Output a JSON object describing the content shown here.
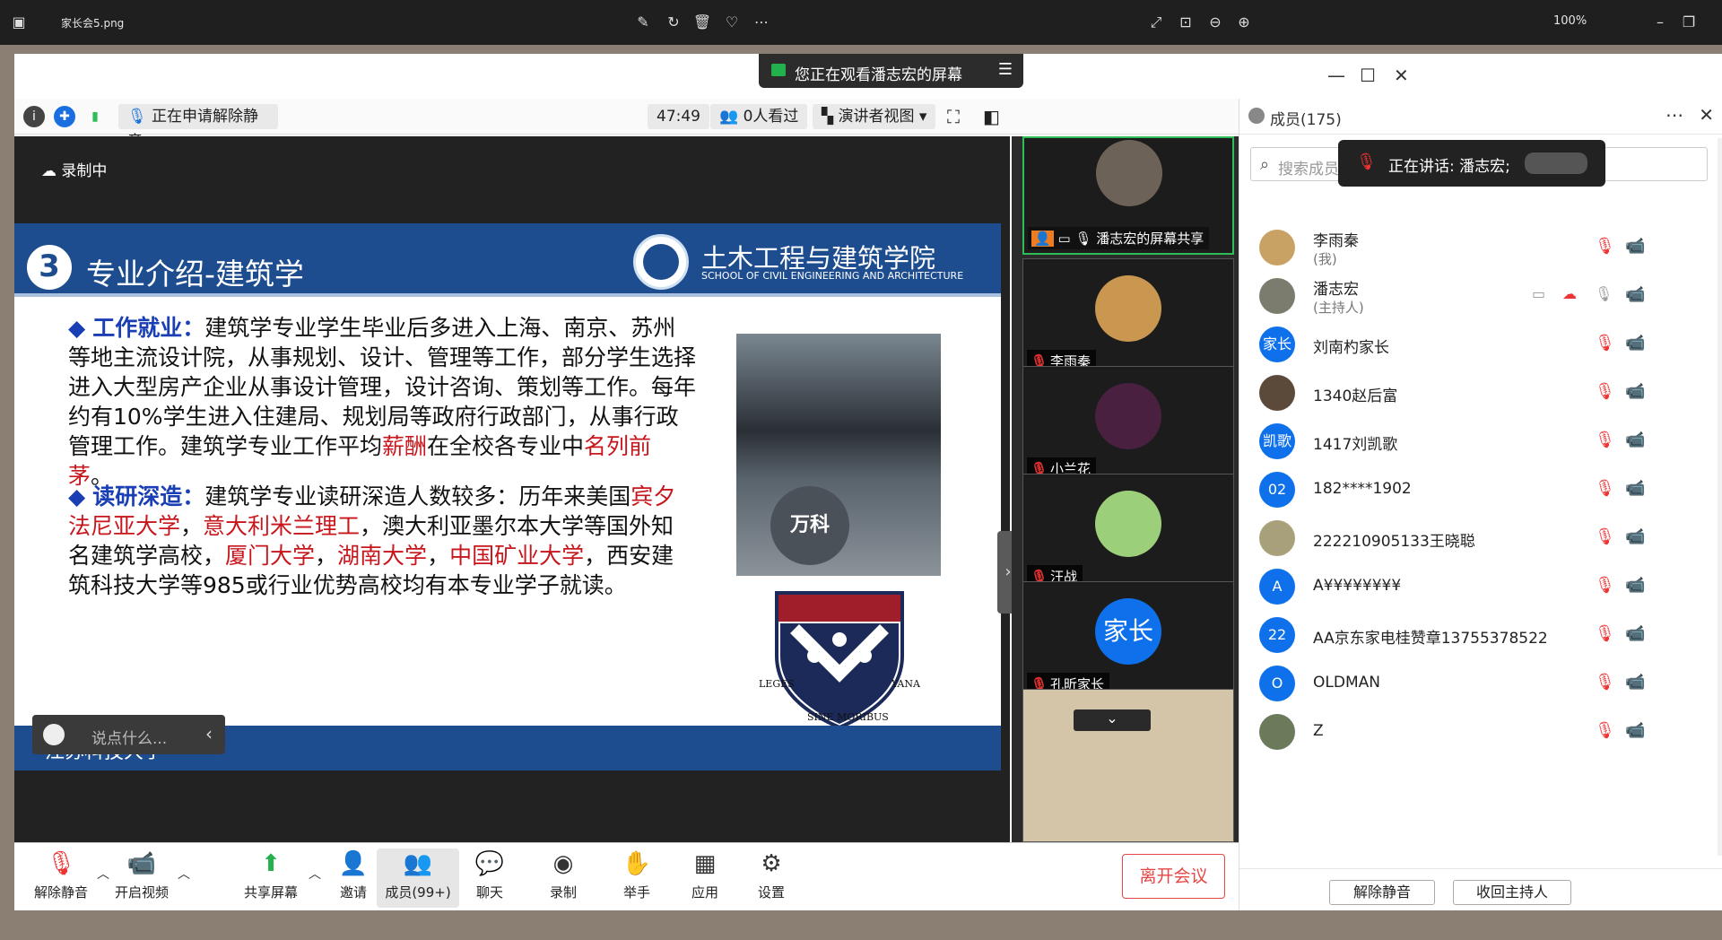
{
  "viewer": {
    "filename": "家长会5.png",
    "zoom": "100%",
    "icons": [
      "image-icon",
      "edit-icon",
      "rotate-icon",
      "delete-icon",
      "heart-icon",
      "more-icon",
      "fullscreen-icon",
      "fit-icon",
      "zoom-out-icon",
      "zoom-in-icon",
      "minimize-icon",
      "restore-icon",
      "close-icon"
    ]
  },
  "meeting": {
    "share_banner": "您正在观看潘志宏的屏幕",
    "requesting_unmute": "正在申请解除静音",
    "timer": "47:49",
    "viewers": "0人看过",
    "view_mode": "演讲者视图",
    "recording": "录制中",
    "chat_placeholder": "说点什么..."
  },
  "slide": {
    "number": "3",
    "title": "专业介绍-建筑学",
    "school_cn": "土木工程与建筑学院",
    "school_en": "SCHOOL OF CIVIL ENGINEERING AND ARCHITECTURE",
    "para1_head": "工作就业：",
    "para1_body": "建筑学专业学生毕业后多进入上海、南京、苏州等地主流设计院，从事规划、设计、管理等工作，部分学生选择进入大型房产企业从事设计管理，设计咨询、策划等工作。每年约有10%学生进入住建局、规划局等政府行政部门，从事行政管理工作。建筑学专业工作平均",
    "para1_red1": "薪酬",
    "para1_mid": "在全校各专业中",
    "para1_red2": "名列前茅",
    "para1_end": "。",
    "para2_head": "读研深造：",
    "para2_body": "建筑学专业读研深造人数较多：历年来美国",
    "para2_red1": "宾夕法尼亚大学",
    "para2_sep1": "，",
    "para2_red2": "意大利米兰理工",
    "para2_mid": "，澳大利亚墨尔本大学等国外知名建筑学高校，",
    "para2_red3": "厦门大学",
    "para2_sep2": "，",
    "para2_red4": "湖南大学",
    "para2_sep3": "，",
    "para2_red5": "中国矿业大学",
    "para2_end": "，西安建筑科技大学等985或行业优势高校均有本专业学子就读。",
    "photo_sign": "万科",
    "crest_motto_left": "LEGES",
    "crest_motto_right": "YANA",
    "crest_motto_bottom": "SINE MORIBUS",
    "footer": "江苏科技大学"
  },
  "videos": [
    {
      "name": "潘志宏的屏幕共享",
      "type": "share"
    },
    {
      "name": "李雨秦",
      "type": "dog"
    },
    {
      "name": "小兰花",
      "type": "flower"
    },
    {
      "name": "汪战",
      "type": "paint"
    },
    {
      "name": "孔昕家长",
      "type": "family",
      "badge": "家长"
    }
  ],
  "controls": {
    "unmute": "解除静音",
    "start_video": "开启视频",
    "share_screen": "共享屏幕",
    "invite": "邀请",
    "members": "成员(99+)",
    "chat": "聊天",
    "record": "录制",
    "raise_hand": "举手",
    "apps": "应用",
    "settings": "设置",
    "leave": "离开会议"
  },
  "panel": {
    "title": "成员(175)",
    "search_placeholder": "搜索成员",
    "speaking": "正在讲话: 潘志宏;",
    "members": [
      {
        "name": "李雨秦",
        "sub": "(我)",
        "avatar": "dog",
        "color": "#c8a265"
      },
      {
        "name": "潘志宏",
        "sub": "(主持人)",
        "avatar": "photo",
        "color": "#7b7b6e"
      },
      {
        "name": "刘南杓家长",
        "sub": "",
        "avatar": "家长",
        "color": "#0e71eb"
      },
      {
        "name": "1340赵后富",
        "sub": "",
        "avatar": "photo",
        "color": "#5b4a3a"
      },
      {
        "name": "1417刘凯歌",
        "sub": "",
        "avatar": "凯歌",
        "color": "#0e71eb"
      },
      {
        "name": "182****1902",
        "sub": "",
        "avatar": "02",
        "color": "#0e71eb"
      },
      {
        "name": "222210905133王晓聪",
        "sub": "",
        "avatar": "photo",
        "color": "#a8a07a"
      },
      {
        "name": "A¥¥¥¥¥¥¥¥",
        "sub": "",
        "avatar": "A",
        "color": "#0e71eb"
      },
      {
        "name": "AA京东家电桂赞章13755378522",
        "sub": "",
        "avatar": "22",
        "color": "#0e71eb"
      },
      {
        "name": "OLDMAN",
        "sub": "",
        "avatar": "O",
        "color": "#0e71eb"
      },
      {
        "name": "Z",
        "sub": "",
        "avatar": "photo",
        "color": "#6a7a5a"
      }
    ],
    "unmute_all": "解除静音",
    "reclaim_host": "收回主持人"
  }
}
